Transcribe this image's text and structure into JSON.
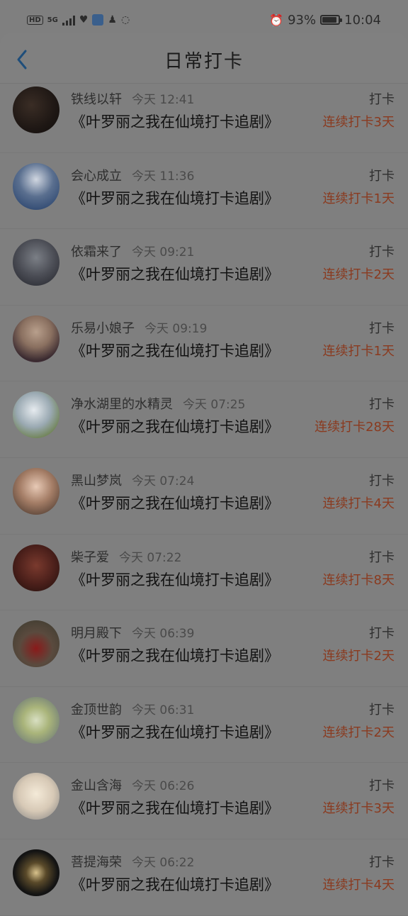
{
  "status_bar": {
    "hd": "HD",
    "network": "5G",
    "battery_pct": "93%",
    "time": "10:04"
  },
  "header": {
    "title": "日常打卡"
  },
  "items": [
    {
      "name": "铁线以轩",
      "time": "今天 12:41",
      "title": "《叶罗丽之我在仙境打卡追剧》",
      "checkin": "打卡",
      "streak": "连续打卡3天"
    },
    {
      "name": "会心成立",
      "time": "今天 11:36",
      "title": "《叶罗丽之我在仙境打卡追剧》",
      "checkin": "打卡",
      "streak": "连续打卡1天"
    },
    {
      "name": "依霜来了",
      "time": "今天 09:21",
      "title": "《叶罗丽之我在仙境打卡追剧》",
      "checkin": "打卡",
      "streak": "连续打卡2天"
    },
    {
      "name": "乐易小娘子",
      "time": "今天 09:19",
      "title": "《叶罗丽之我在仙境打卡追剧》",
      "checkin": "打卡",
      "streak": "连续打卡1天"
    },
    {
      "name": "净水湖里的水精灵",
      "time": "今天 07:25",
      "title": "《叶罗丽之我在仙境打卡追剧》",
      "checkin": "打卡",
      "streak": "连续打卡28天"
    },
    {
      "name": "黑山梦岚",
      "time": "今天 07:24",
      "title": "《叶罗丽之我在仙境打卡追剧》",
      "checkin": "打卡",
      "streak": "连续打卡4天"
    },
    {
      "name": "柴子爱",
      "time": "今天 07:22",
      "title": "《叶罗丽之我在仙境打卡追剧》",
      "checkin": "打卡",
      "streak": "连续打卡8天"
    },
    {
      "name": "明月殿下",
      "time": "今天 06:39",
      "title": "《叶罗丽之我在仙境打卡追剧》",
      "checkin": "打卡",
      "streak": "连续打卡2天"
    },
    {
      "name": "金顶世韵",
      "time": "今天 06:31",
      "title": "《叶罗丽之我在仙境打卡追剧》",
      "checkin": "打卡",
      "streak": "连续打卡2天"
    },
    {
      "name": "金山含海",
      "time": "今天 06:26",
      "title": "《叶罗丽之我在仙境打卡追剧》",
      "checkin": "打卡",
      "streak": "连续打卡3天"
    },
    {
      "name": "菩提海荣",
      "time": "今天 06:22",
      "title": "《叶罗丽之我在仙境打卡追剧》",
      "checkin": "打卡",
      "streak": "连续打卡4天"
    }
  ]
}
